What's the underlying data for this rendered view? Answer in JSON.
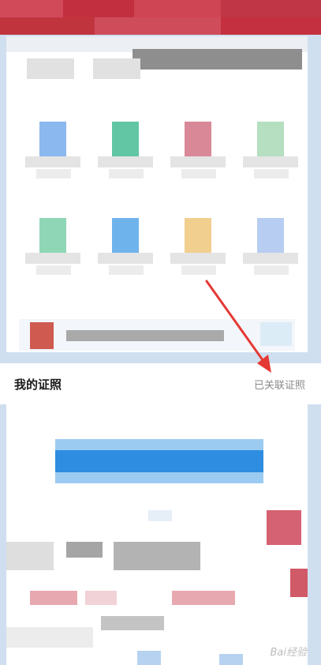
{
  "section": {
    "title": "我的证照",
    "linked_label": "已关联证照"
  },
  "watermark": "Bai经验",
  "colors": {
    "banner": "#c63a4a",
    "primary": "#2e8de0",
    "arrow": "#e53935"
  }
}
